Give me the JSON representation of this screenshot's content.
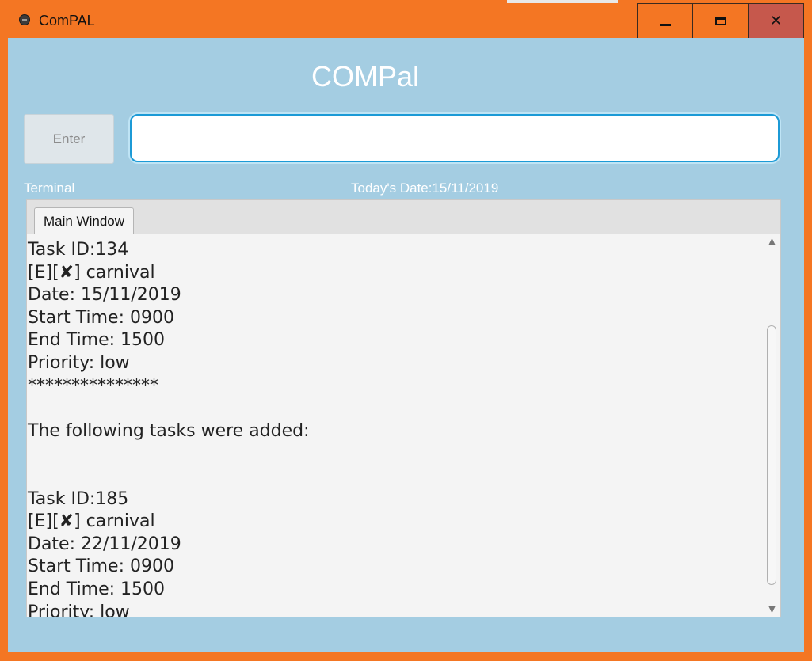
{
  "window": {
    "title": "ComPAL",
    "controls": {
      "minimize_icon": "minimize-icon",
      "maximize_icon": "maximize-icon",
      "close_label": "✕"
    }
  },
  "app": {
    "title": "COMPal",
    "enter_button_label": "Enter",
    "command_input_value": "",
    "command_input_placeholder": "",
    "terminal_label": "Terminal",
    "date_label": "Today's Date:15/11/2019"
  },
  "tabs": [
    {
      "label": "Main Window",
      "selected": true
    }
  ],
  "output": {
    "lines": [
      "Task ID:134",
      "[E][✘] carnival",
      "Date: 15/11/2019",
      "Start Time: 0900",
      "End Time: 1500",
      "Priority: low",
      "***************",
      "",
      "The following tasks were added:",
      "",
      "",
      "Task ID:185",
      "[E][✘] carnival",
      "Date: 22/11/2019",
      "Start Time: 0900",
      "End Time: 1500",
      "Priority: low"
    ]
  },
  "scrollbar": {
    "up_icon": "▲",
    "down_icon": "▼"
  },
  "colors": {
    "window_frame": "#f47623",
    "content_bg": "#a4cde2",
    "close_button": "#c6584c",
    "input_border": "#1c9ad6"
  }
}
